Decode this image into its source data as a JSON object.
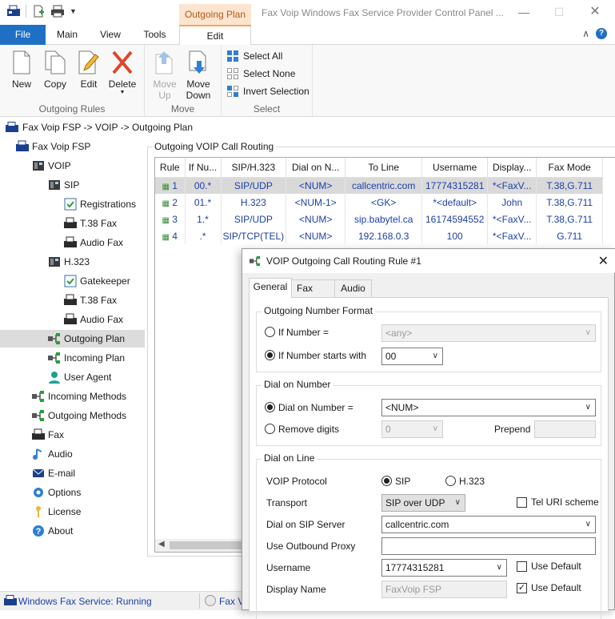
{
  "window": {
    "title": "Fax Voip Windows Fax Service Provider Control Panel ...",
    "context_tab": "Outgoing Plan"
  },
  "ribbon_tabs": [
    "File",
    "Main",
    "View",
    "Tools",
    "Edit"
  ],
  "ribbon": {
    "groups": {
      "outgoing_rules": "Outgoing Rules",
      "move": "Move",
      "select": "Select"
    },
    "buttons": {
      "new": "New",
      "copy": "Copy",
      "edit": "Edit",
      "delete": "Delete",
      "move_up_1": "Move",
      "move_up_2": "Up",
      "move_down_1": "Move",
      "move_down_2": "Down",
      "select_all": "Select All",
      "select_none": "Select None",
      "invert_selection": "Invert Selection"
    }
  },
  "breadcrumb": "Fax Voip FSP -> VOIP -> Outgoing Plan",
  "tree": {
    "root": "Fax Voip FSP",
    "voip": "VOIP",
    "sip": "SIP",
    "registrations": "Registrations",
    "t38_sip": "T.38 Fax",
    "audio_sip": "Audio Fax",
    "h323": "H.323",
    "gatekeeper": "Gatekeeper",
    "t38_h323": "T.38 Fax",
    "audio_h323": "Audio Fax",
    "outgoing_plan": "Outgoing Plan",
    "incoming_plan": "Incoming Plan",
    "user_agent": "User Agent",
    "incoming_methods": "Incoming Methods",
    "outgoing_methods": "Outgoing Methods",
    "fax": "Fax",
    "audio": "Audio",
    "email": "E-mail",
    "options": "Options",
    "license": "License",
    "about": "About"
  },
  "routing": {
    "title": "Outgoing VOIP Call Routing",
    "columns": [
      "Rule",
      "If Nu...",
      "SIP/H.323",
      "Dial on N...",
      "To Line",
      "Username",
      "Display...",
      "Fax Mode"
    ],
    "rows": [
      [
        "1",
        "00.*",
        "SIP/UDP",
        "<NUM>",
        "callcentric.com",
        "17774315281",
        "*<FaxV...",
        "T.38,G.711"
      ],
      [
        "2",
        "01.*",
        "H.323",
        "<NUM-1>",
        "<GK>",
        "*<default>",
        "John",
        "T.38,G.711"
      ],
      [
        "3",
        "1.*",
        "SIP/UDP",
        "<NUM>",
        "sip.babytel.ca",
        "16174594552",
        "*<FaxV...",
        "T.38,G.711"
      ],
      [
        "4",
        ".*",
        "SIP/TCP(TEL)",
        "<NUM>",
        "192.168.0.3",
        "100",
        "*<FaxV...",
        "G.711"
      ]
    ]
  },
  "status": {
    "service": "Windows Fax Service: Running",
    "second": "Fax V"
  },
  "dialog": {
    "title": "VOIP Outgoing Call Routing Rule #1",
    "tabs": [
      "General",
      "Fax",
      "Audio"
    ],
    "outgoing_number_format": {
      "title": "Outgoing Number Format",
      "if_number": "If Number =",
      "if_number_value": "<any>",
      "if_starts": "If Number starts with",
      "if_starts_value": "00"
    },
    "dial_on_number": {
      "title": "Dial on Number",
      "dial_label": "Dial on Number =",
      "dial_value": "<NUM>",
      "remove_digits": "Remove digits",
      "remove_value": "0",
      "prepend": "Prepend"
    },
    "dial_on_line": {
      "title": "Dial on Line",
      "protocol_label": "VOIP Protocol",
      "sip": "SIP",
      "h323": "H.323",
      "transport_label": "Transport",
      "transport_value": "SIP over UDP",
      "tel_uri": "Tel URI scheme",
      "server_label": "Dial on SIP Server",
      "server_value": "callcentric.com",
      "proxy_label": "Use Outbound Proxy",
      "proxy_value": "",
      "username_label": "Username",
      "username_value": "17774315281",
      "use_default_1": "Use Default",
      "display_label": "Display Name",
      "display_value": "FaxVoip FSP",
      "use_default_2": "Use Default"
    }
  },
  "colors": {
    "accent": "#1f6fc5",
    "context_tab_bg": "#fde4cf",
    "context_tab_text": "#b05a1a",
    "table_text": "#1c3fa8",
    "status_text": "#1c3fa8"
  }
}
